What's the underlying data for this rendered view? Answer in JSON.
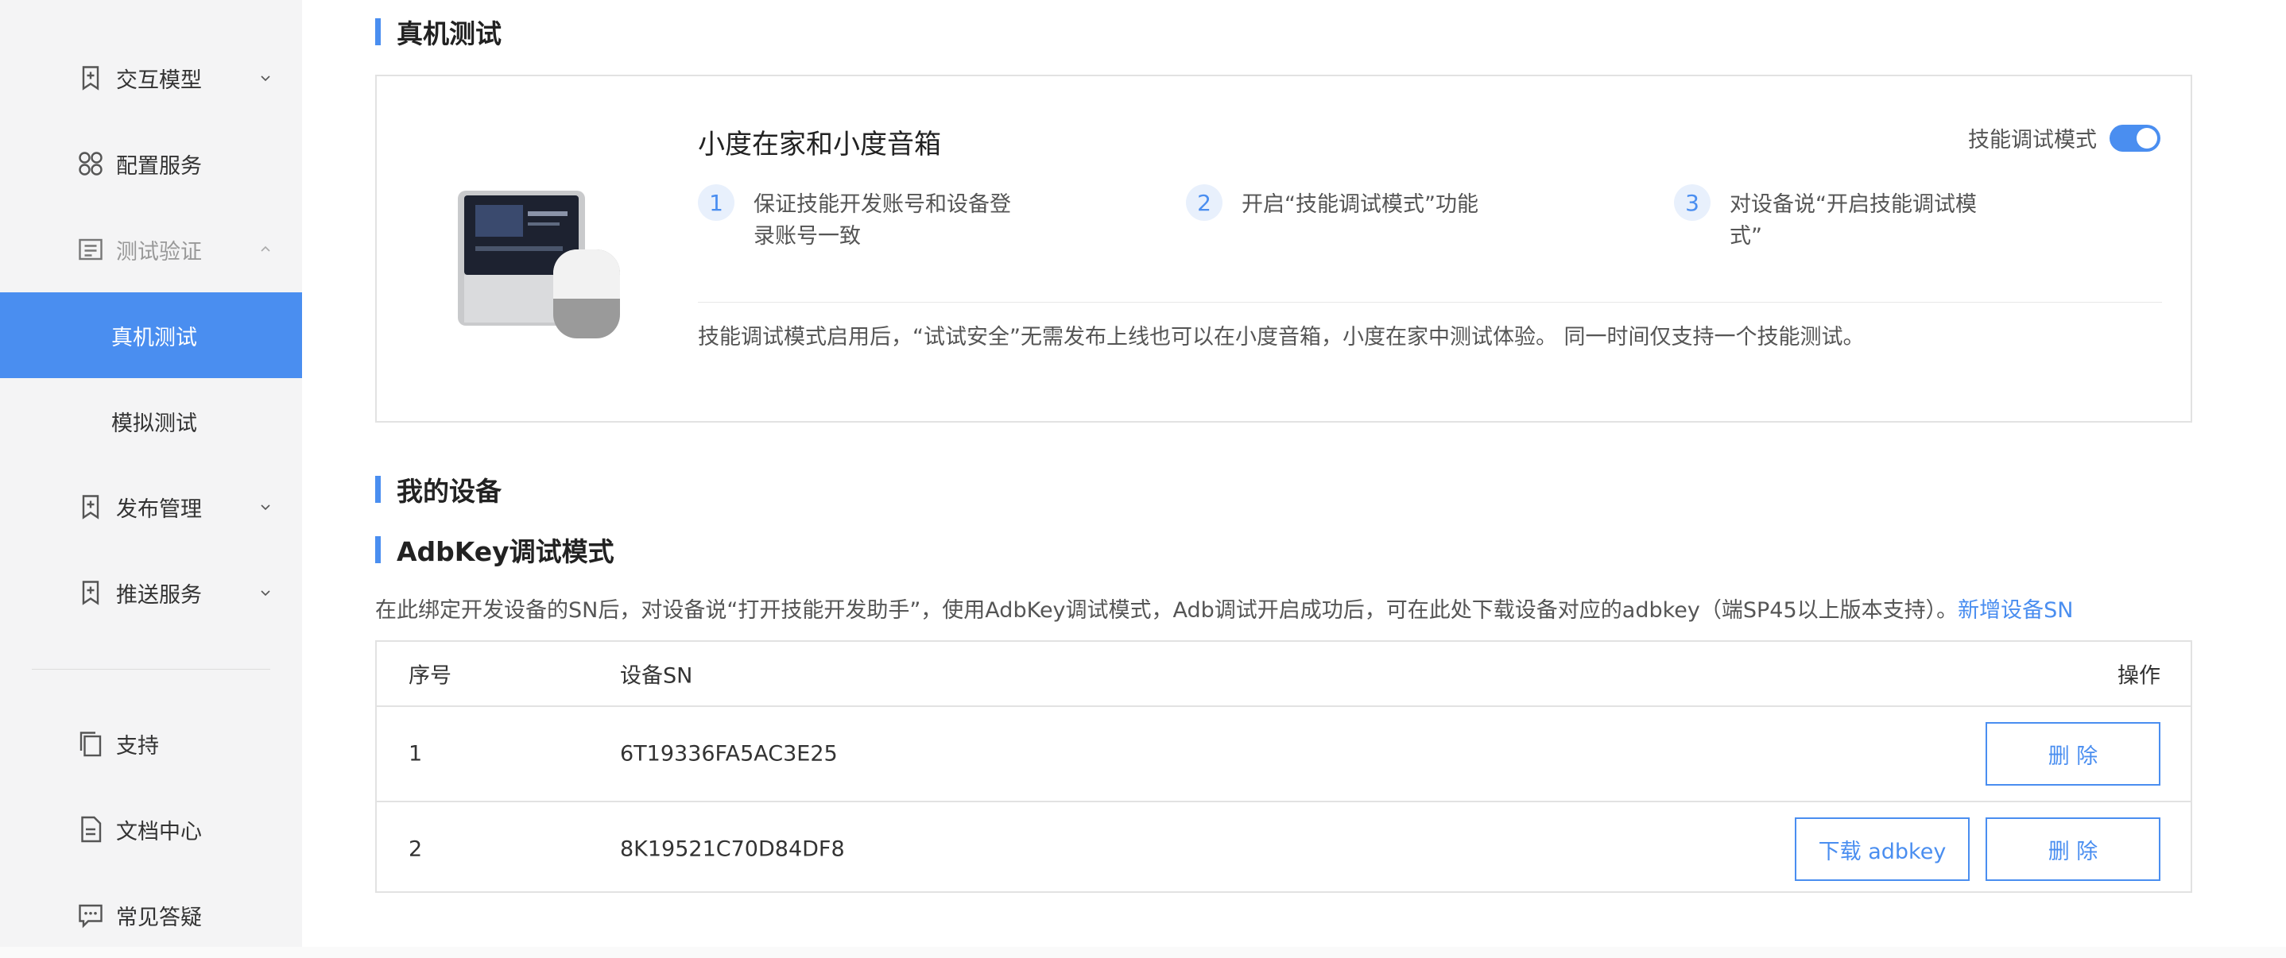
{
  "sidebar": {
    "items": [
      {
        "label": "交互模型",
        "icon": "bookmark-plus-icon"
      },
      {
        "label": "配置服务",
        "icon": "grid-icon"
      },
      {
        "label": "测试验证",
        "icon": "document-list-icon"
      },
      {
        "label": "真机测试"
      },
      {
        "label": "模拟测试"
      },
      {
        "label": "发布管理",
        "icon": "bookmark-plus-icon"
      },
      {
        "label": "推送服务",
        "icon": "bookmark-plus-icon"
      },
      {
        "label": "支持",
        "icon": "copy-icon"
      },
      {
        "label": "文档中心",
        "icon": "document-icon"
      },
      {
        "label": "常见答疑",
        "icon": "chat-icon"
      }
    ]
  },
  "main": {
    "section_real_device": "真机测试",
    "card": {
      "title": "小度在家和小度音箱",
      "toggle_label": "技能调试模式",
      "toggle_on": true,
      "steps": [
        {
          "num": "1",
          "text": "保证技能开发账号和设备登录账号一致"
        },
        {
          "num": "2",
          "text": "开启“技能调试模式”功能"
        },
        {
          "num": "3",
          "text": "对设备说“开启技能调试模式”"
        }
      ],
      "note": "技能调试模式启用后，“试试安全”无需发布上线也可以在小度音箱，小度在家中测试体验。 同一时间仅支持一个技能测试。"
    },
    "section_my_devices": "我的设备",
    "section_adbkey": "AdbKey调试模式",
    "description": "在此绑定开发设备的SN后，对设备说“打开技能开发助手”，使用AdbKey调试模式，Adb调试开启成功后，可在此处下载设备对应的adbkey（端SP45以上版本支持）。",
    "add_device_link": "新增设备SN",
    "table": {
      "headers": {
        "index": "序号",
        "sn": "设备SN",
        "op": "操作"
      },
      "rows": [
        {
          "index": "1",
          "sn": "6T19336FA5AC3E25",
          "download": "",
          "delete": "删 除"
        },
        {
          "index": "2",
          "sn": "8K19521C70D84DF8",
          "download": "下载 adbkey",
          "delete": "删 除"
        }
      ]
    }
  },
  "colors": {
    "accent": "#4a8ef0",
    "sidebar_bg": "#f4f4f5"
  }
}
